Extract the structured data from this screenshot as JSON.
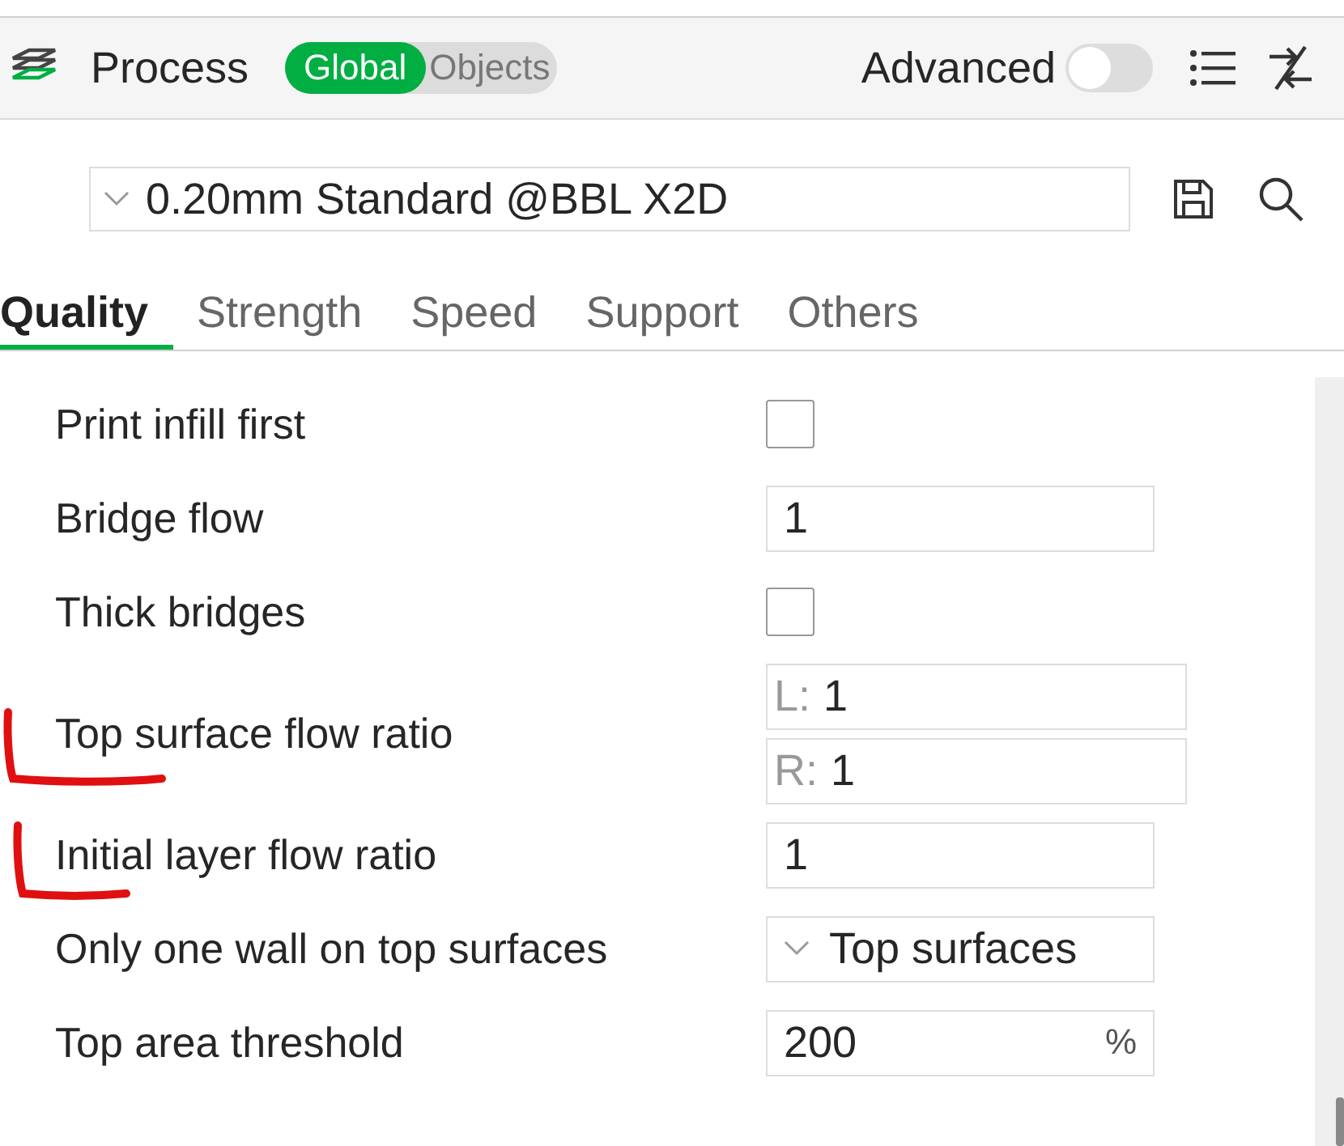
{
  "header": {
    "title": "Process",
    "scope_tabs": [
      {
        "label": "Global",
        "selected": true
      },
      {
        "label": "Objects",
        "selected": false
      }
    ],
    "advanced": {
      "label": "Advanced",
      "on": false
    }
  },
  "preset": {
    "value": "0.20mm Standard @BBL X2D"
  },
  "tabs": [
    {
      "label": "Quality",
      "selected": true
    },
    {
      "label": "Strength",
      "selected": false
    },
    {
      "label": "Speed",
      "selected": false
    },
    {
      "label": "Support",
      "selected": false
    },
    {
      "label": "Others",
      "selected": false
    }
  ],
  "settings": [
    {
      "kind": "checkbox",
      "label": "Print infill first",
      "checked": false,
      "highlighted": false
    },
    {
      "kind": "text",
      "label": "Bridge flow",
      "value": "1",
      "highlighted": false
    },
    {
      "kind": "checkbox",
      "label": "Thick bridges",
      "checked": false,
      "highlighted": false
    },
    {
      "kind": "dual",
      "label": "Top surface flow ratio",
      "fields": [
        {
          "prefix": "L:",
          "value": "1"
        },
        {
          "prefix": "R:",
          "value": "1"
        }
      ],
      "highlighted": true
    },
    {
      "kind": "text",
      "label": "Initial layer flow ratio",
      "value": "1",
      "highlighted": true
    },
    {
      "kind": "dropdown",
      "label": "Only one wall on top surfaces",
      "value": "Top surfaces",
      "highlighted": false
    },
    {
      "kind": "text",
      "label": "Top area threshold",
      "value": "200",
      "unit": "%",
      "highlighted": false
    }
  ]
}
